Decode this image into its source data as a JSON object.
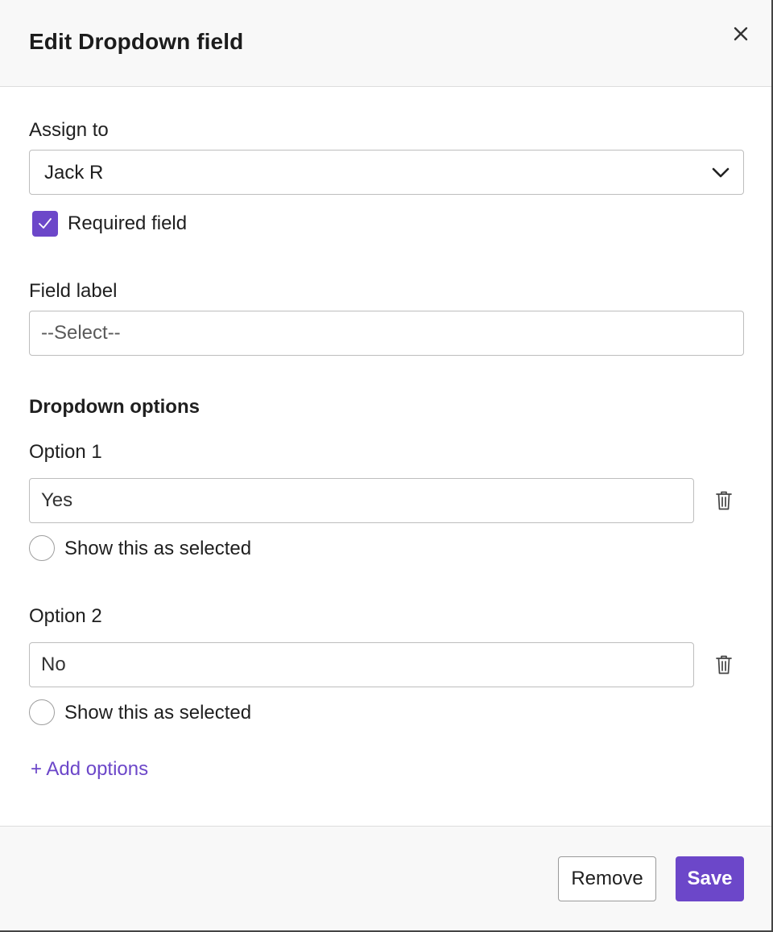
{
  "dialog": {
    "title": "Edit Dropdown field",
    "close_icon": "close-icon"
  },
  "assign": {
    "label": "Assign to",
    "selected": "Jack R",
    "chevron_icon": "chevron-down-icon"
  },
  "required": {
    "label": "Required field",
    "checked": true,
    "check_icon": "check-icon"
  },
  "field_label": {
    "label": "Field label",
    "placeholder": "--Select--"
  },
  "dropdown_options": {
    "title": "Dropdown options",
    "options": [
      {
        "label": "Option 1",
        "value": "Yes",
        "selected_label": "Show this as selected",
        "selected": false
      },
      {
        "label": "Option 2",
        "value": "No",
        "selected_label": "Show this as selected",
        "selected": false
      }
    ],
    "delete_icon": "trash-icon",
    "add_label": "+ Add options"
  },
  "footer": {
    "remove_label": "Remove",
    "save_label": "Save"
  },
  "colors": {
    "accent": "#6c47c9",
    "border": "#bdbdbd",
    "header_bg": "#f8f8f8"
  }
}
